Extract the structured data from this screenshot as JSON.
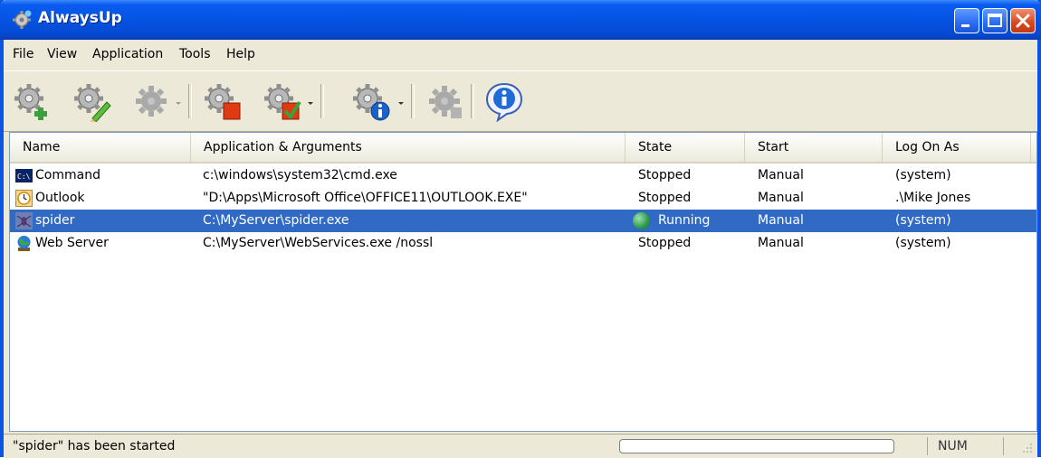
{
  "window": {
    "title": "AlwaysUp",
    "title_color": "#0554e3",
    "close_color": "#d9461e"
  },
  "menu": [
    "File",
    "View",
    "Application",
    "Tools",
    "Help"
  ],
  "toolbar": {
    "buttons": [
      {
        "name": "add-application-button",
        "icon": "gear-plus-icon"
      },
      {
        "name": "edit-application-button",
        "icon": "gear-pencil-icon"
      },
      {
        "name": "start-application-button",
        "icon": "gear-disabled-icon"
      },
      {
        "name": "stop-application-button",
        "icon": "gear-stop-icon"
      },
      {
        "name": "restart-application-button",
        "icon": "gear-restart-icon"
      },
      {
        "name": "report-application-button",
        "icon": "gear-info-icon"
      },
      {
        "name": "pause-application-button",
        "icon": "gear-disabled-icon"
      },
      {
        "name": "about-button",
        "icon": "info-bubble-icon"
      }
    ]
  },
  "list": {
    "columns": [
      "Name",
      "Application & Arguments",
      "State",
      "Start",
      "Log On As"
    ],
    "rows": [
      {
        "name": "Command",
        "app": "c:\\windows\\system32\\cmd.exe",
        "state": "Stopped",
        "start": "Manual",
        "logon": "(system)",
        "icon": "console-icon",
        "selected": false
      },
      {
        "name": "Outlook",
        "app": "\"D:\\Apps\\Microsoft Office\\OFFICE11\\OUTLOOK.EXE\"",
        "state": "Stopped",
        "start": "Manual",
        "logon": ".\\Mike Jones",
        "icon": "clock-icon",
        "selected": false
      },
      {
        "name": "spider",
        "app": "C:\\MyServer\\spider.exe",
        "state": "Running",
        "start": "Manual",
        "logon": "(system)",
        "icon": "spider-icon",
        "selected": true
      },
      {
        "name": "Web Server",
        "app": "C:\\MyServer\\WebServices.exe /nossl",
        "state": "Stopped",
        "start": "Manual",
        "logon": "(system)",
        "icon": "globe-icon",
        "selected": false
      }
    ],
    "selection_color": "#316ac5",
    "running_color": "#2b9a4a"
  },
  "status": {
    "message": "\"spider\" has been started",
    "progress": 0,
    "num": "NUM"
  }
}
